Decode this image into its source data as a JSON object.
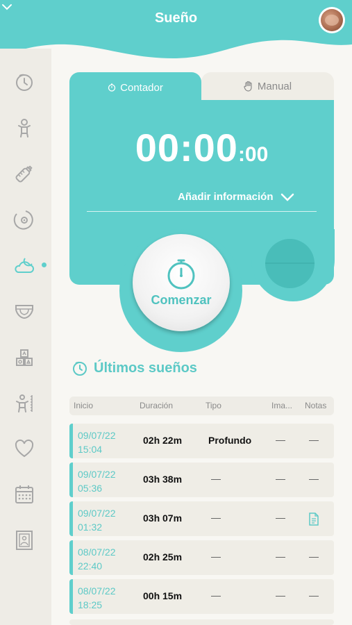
{
  "header": {
    "title": "Sueño"
  },
  "tabs": {
    "active": "Contador",
    "inactive": "Manual"
  },
  "timer": {
    "main": "00:00",
    "seconds": ":00"
  },
  "add_info": "Añadir información",
  "start_button": "Comenzar",
  "section": {
    "title": "Últimos sueños"
  },
  "table": {
    "headers": [
      "Inicio",
      "Duración",
      "Tipo",
      "Ima...",
      "Notas"
    ],
    "rows": [
      {
        "date": "09/07/22",
        "time": "15:04",
        "duration": "02h 22m",
        "type": "Profundo",
        "image": "—",
        "notes": "—"
      },
      {
        "date": "09/07/22",
        "time": "05:36",
        "duration": "03h 38m",
        "type": "—",
        "image": "—",
        "notes": "—"
      },
      {
        "date": "09/07/22",
        "time": "01:32",
        "duration": "03h 07m",
        "type": "—",
        "image": "—",
        "notes": "note-icon"
      },
      {
        "date": "08/07/22",
        "time": "22:40",
        "duration": "02h 25m",
        "type": "—",
        "image": "—",
        "notes": "—"
      },
      {
        "date": "08/07/22",
        "time": "18:25",
        "duration": "00h 15m",
        "type": "—",
        "image": "—",
        "notes": "—"
      }
    ]
  },
  "sidebar": {
    "items": [
      "timer-icon",
      "baby-icon",
      "bottle-icon",
      "breast-icon",
      "sleep-icon",
      "diaper-icon",
      "toys-icon",
      "growth-icon",
      "heart-icon",
      "calendar-icon",
      "photo-frame-icon"
    ],
    "active": "sleep-icon"
  },
  "colors": {
    "accent": "#5fcfcc",
    "accent_dark": "#49bdb9",
    "sidebar_bg": "#eeece6",
    "page_bg": "#f8f7f3"
  }
}
